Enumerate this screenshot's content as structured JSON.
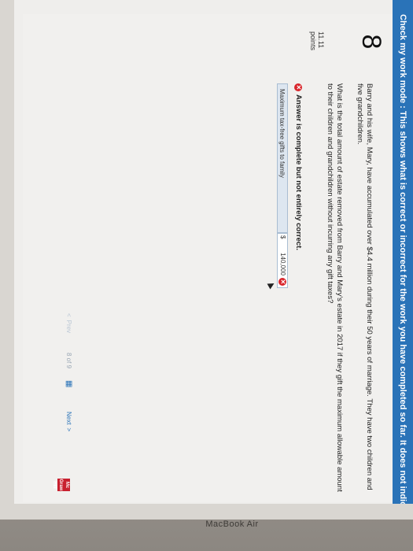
{
  "banner": {
    "text": "Check my work mode : This shows what is correct or incorrect for the work you have completed so far. It does not indicate comp"
  },
  "question": {
    "number": "8",
    "points_value": "11.11",
    "points_label": "points",
    "paragraph1": "Barry and his wife, Mary, have accumulated over $4.4 million during their 50 years of marriage. They have two children and five grandchildren.",
    "paragraph2": "What is the total amount of estate removed from Barry and Mary's estate in 2017 if they gift the maximum allowable amount to their children and grandchildren without incurring any gift taxes?"
  },
  "answer": {
    "status": "Answer is complete but not entirely correct.",
    "row_label": "Maximum tax-free gifts to family",
    "currency": "$",
    "value": "140,000"
  },
  "navigation": {
    "prev_label": "Prev",
    "page_text": "8 of 9",
    "next_label": "Next"
  },
  "logo": {
    "text": "Mc Graw Hill"
  },
  "device": {
    "label": "MacBook Air"
  }
}
